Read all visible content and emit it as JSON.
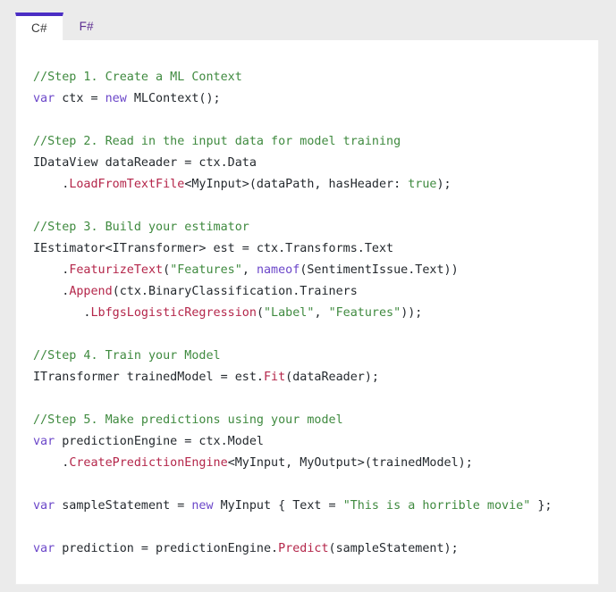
{
  "tabs": [
    {
      "label": "C#",
      "active": true
    },
    {
      "label": "F#",
      "active": false
    }
  ],
  "colors": {
    "accent": "#4b2ec4",
    "tab_inactive_text": "#5c2d91",
    "comment": "#3f8a3f",
    "keyword": "#6b46c9",
    "string": "#3f8a3f",
    "method": "#b4264a",
    "plain": "#24292e",
    "page_background": "#ebebeb",
    "card_background": "#ffffff"
  },
  "code": {
    "language": "C#",
    "lines": [
      [
        {
          "t": "//Step 1. Create a ML Context",
          "c": "cmt"
        }
      ],
      [
        {
          "t": "var",
          "c": "kw"
        },
        {
          "t": " ctx = ",
          "c": "plain"
        },
        {
          "t": "new",
          "c": "kw"
        },
        {
          "t": " MLContext();",
          "c": "plain"
        }
      ],
      [],
      [
        {
          "t": "//Step 2. Read in the input data for model training",
          "c": "cmt"
        }
      ],
      [
        {
          "t": "IDataView dataReader = ctx.Data",
          "c": "plain"
        }
      ],
      [
        {
          "t": "    .",
          "c": "plain"
        },
        {
          "t": "LoadFromTextFile",
          "c": "fn"
        },
        {
          "t": "<MyInput>(dataPath, hasHeader: ",
          "c": "plain"
        },
        {
          "t": "true",
          "c": "lit"
        },
        {
          "t": ");",
          "c": "plain"
        }
      ],
      [],
      [
        {
          "t": "//Step 3. Build your estimator",
          "c": "cmt"
        }
      ],
      [
        {
          "t": "IEstimator<ITransformer> est = ctx.Transforms.Text",
          "c": "plain"
        }
      ],
      [
        {
          "t": "    .",
          "c": "plain"
        },
        {
          "t": "FeaturizeText",
          "c": "fn"
        },
        {
          "t": "(",
          "c": "plain"
        },
        {
          "t": "\"Features\"",
          "c": "str"
        },
        {
          "t": ", ",
          "c": "plain"
        },
        {
          "t": "nameof",
          "c": "kw"
        },
        {
          "t": "(SentimentIssue.Text))",
          "c": "plain"
        }
      ],
      [
        {
          "t": "    .",
          "c": "plain"
        },
        {
          "t": "Append",
          "c": "fn"
        },
        {
          "t": "(ctx.BinaryClassification.Trainers",
          "c": "plain"
        }
      ],
      [
        {
          "t": "       .",
          "c": "plain"
        },
        {
          "t": "LbfgsLogisticRegression",
          "c": "fn"
        },
        {
          "t": "(",
          "c": "plain"
        },
        {
          "t": "\"Label\"",
          "c": "str"
        },
        {
          "t": ", ",
          "c": "plain"
        },
        {
          "t": "\"Features\"",
          "c": "str"
        },
        {
          "t": "));",
          "c": "plain"
        }
      ],
      [],
      [
        {
          "t": "//Step 4. Train your Model",
          "c": "cmt"
        }
      ],
      [
        {
          "t": "ITransformer trainedModel = est.",
          "c": "plain"
        },
        {
          "t": "Fit",
          "c": "fn"
        },
        {
          "t": "(dataReader);",
          "c": "plain"
        }
      ],
      [],
      [
        {
          "t": "//Step 5. Make predictions using your model",
          "c": "cmt"
        }
      ],
      [
        {
          "t": "var",
          "c": "kw"
        },
        {
          "t": " predictionEngine = ctx.Model",
          "c": "plain"
        }
      ],
      [
        {
          "t": "    .",
          "c": "plain"
        },
        {
          "t": "CreatePredictionEngine",
          "c": "fn"
        },
        {
          "t": "<MyInput, MyOutput>(trainedModel);",
          "c": "plain"
        }
      ],
      [],
      [
        {
          "t": "var",
          "c": "kw"
        },
        {
          "t": " sampleStatement = ",
          "c": "plain"
        },
        {
          "t": "new",
          "c": "kw"
        },
        {
          "t": " MyInput { Text = ",
          "c": "plain"
        },
        {
          "t": "\"This is a horrible movie\"",
          "c": "str"
        },
        {
          "t": " };",
          "c": "plain"
        }
      ],
      [],
      [
        {
          "t": "var",
          "c": "kw"
        },
        {
          "t": " prediction = predictionEngine.",
          "c": "plain"
        },
        {
          "t": "Predict",
          "c": "fn"
        },
        {
          "t": "(sampleStatement);",
          "c": "plain"
        }
      ]
    ]
  }
}
